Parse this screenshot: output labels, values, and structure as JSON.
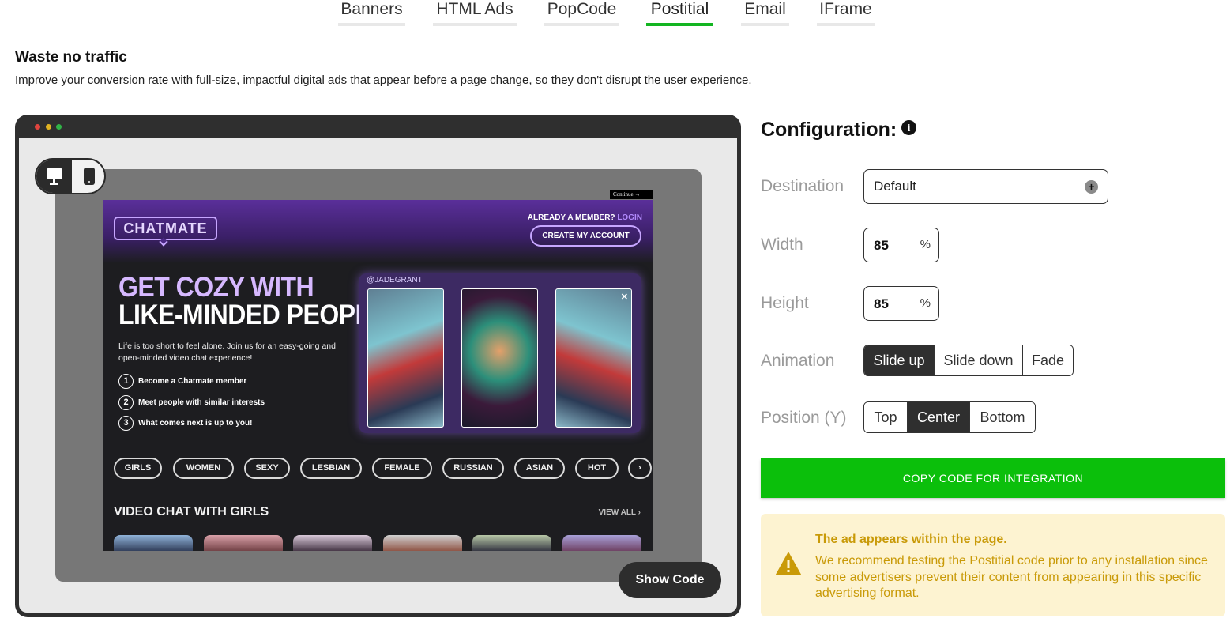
{
  "tabs": [
    {
      "label": "Banners"
    },
    {
      "label": "HTML Ads"
    },
    {
      "label": "PopCode"
    },
    {
      "label": "Postitial",
      "active": true
    },
    {
      "label": "Email"
    },
    {
      "label": "IFrame"
    }
  ],
  "intro": {
    "title": "Waste no traffic",
    "description": "Improve your conversion rate with full-size, impactful digital ads that appear before a page change, so they don't disrupt the user experience."
  },
  "preview": {
    "device_toggle": {
      "active": "desktop"
    },
    "show_code_label": "Show Code",
    "ad": {
      "continue_label": "Continue →",
      "logo": "CHATMATE",
      "member_text": "ALREADY A MEMBER?",
      "login_text": "LOGIN",
      "create_account": "CREATE MY ACCOUNT",
      "headline_line1": "GET COZY WITH",
      "headline_line2": "LIKE-MINDED PEOPLE",
      "description": "Life is too short to feel alone. Join us for an easy-going and open-minded video chat experience!",
      "steps": [
        {
          "num": "1",
          "text": "Become a Chatmate member"
        },
        {
          "num": "2",
          "text": "Meet people with similar interests"
        },
        {
          "num": "3",
          "text": "What comes next is up to you!"
        }
      ],
      "handle": "@JADEGRANT",
      "tags": [
        "GIRLS",
        "WOMEN",
        "SEXY",
        "LESBIAN",
        "FEMALE",
        "RUSSIAN",
        "ASIAN",
        "HOT"
      ],
      "section_title": "VIDEO CHAT WITH GIRLS",
      "view_all": "VIEW ALL"
    }
  },
  "config": {
    "title": "Configuration:",
    "destination": {
      "label": "Destination",
      "value": "Default"
    },
    "width": {
      "label": "Width",
      "value": "85",
      "unit": "%"
    },
    "height": {
      "label": "Height",
      "value": "85",
      "unit": "%"
    },
    "animation": {
      "label": "Animation",
      "options": [
        "Slide up",
        "Slide down",
        "Fade"
      ],
      "selected": "Slide up"
    },
    "position": {
      "label": "Position (Y)",
      "options": [
        "Top",
        "Center",
        "Bottom"
      ],
      "selected": "Center"
    },
    "copy_button": "COPY CODE FOR INTEGRATION",
    "notice": {
      "title": "The ad appears within the page.",
      "body": "We recommend testing the Postitial code prior to any installation since some advertisers prevent their content from appearing in this specific advertising format."
    }
  },
  "colors": {
    "accent_green": "#0bbf0b",
    "tab_active_underline": "#13b521",
    "notice_bg": "#fdf3d1",
    "notice_text": "#c99a08",
    "dark": "#2f2f2f"
  }
}
